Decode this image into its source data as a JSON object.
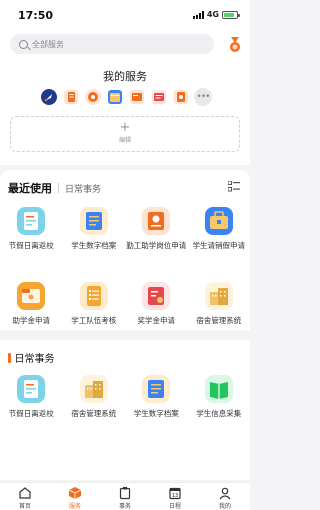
{
  "status_bar": {
    "time": "17:50",
    "network": "4G"
  },
  "search": {
    "placeholder": "全部服务"
  },
  "my_services": {
    "title": "我的服务",
    "favorites": [
      {
        "icon": "rocket-icon",
        "color": "#1e3a8a"
      },
      {
        "icon": "document-icon",
        "color": "#f36d21"
      },
      {
        "icon": "clock-icon",
        "color": "#f36d21"
      },
      {
        "icon": "calendar-icon",
        "color": "#3b82f6"
      },
      {
        "icon": "card-icon",
        "color": "#f36d21"
      },
      {
        "icon": "image-icon",
        "color": "#e5484d"
      },
      {
        "icon": "file-icon",
        "color": "#f36d21"
      }
    ],
    "edit_label": "编辑"
  },
  "tabs": {
    "active": "最近使用",
    "inactive": "日常事务"
  },
  "recent_apps": [
    {
      "label": "节假日离返校",
      "icon": "leave-form-icon",
      "color": "#7fd3e8"
    },
    {
      "label": "学生数字档案",
      "icon": "archive-icon",
      "color": "#f6c76b"
    },
    {
      "label": "勤工助学岗位申请",
      "icon": "badge-icon",
      "color": "#f36d21"
    },
    {
      "label": "学生请销假申请",
      "icon": "briefcase-icon",
      "color": "#3b82f6"
    },
    {
      "label": "助学金申请",
      "icon": "folder-icon",
      "color": "#f7a531"
    },
    {
      "label": "学工队伍考核",
      "icon": "checklist-icon",
      "color": "#f7a531"
    },
    {
      "label": "奖学金申请",
      "icon": "award-icon",
      "color": "#e5484d"
    },
    {
      "label": "宿舍管理系统",
      "icon": "building-icon",
      "color": "#f0c36b"
    }
  ],
  "daily": {
    "title": "日常事务",
    "apps": [
      {
        "label": "节假日离返校",
        "icon": "leave-form-icon",
        "color": "#7fd3e8"
      },
      {
        "label": "宿舍管理系统",
        "icon": "building-icon",
        "color": "#f0c36b"
      },
      {
        "label": "学生数字档案",
        "icon": "archive-icon",
        "color": "#f6c76b"
      },
      {
        "label": "学生信息采集",
        "icon": "book-icon",
        "color": "#22c55e"
      }
    ]
  },
  "bottom_nav": [
    {
      "label": "首页",
      "icon": "home-icon"
    },
    {
      "label": "服务",
      "icon": "service-icon",
      "active": true
    },
    {
      "label": "事务",
      "icon": "clipboard-icon"
    },
    {
      "label": "日程",
      "icon": "calendar-icon"
    },
    {
      "label": "我的",
      "icon": "profile-icon"
    }
  ],
  "colors": {
    "accent": "#f36d21",
    "background": "#f4f4f6"
  }
}
